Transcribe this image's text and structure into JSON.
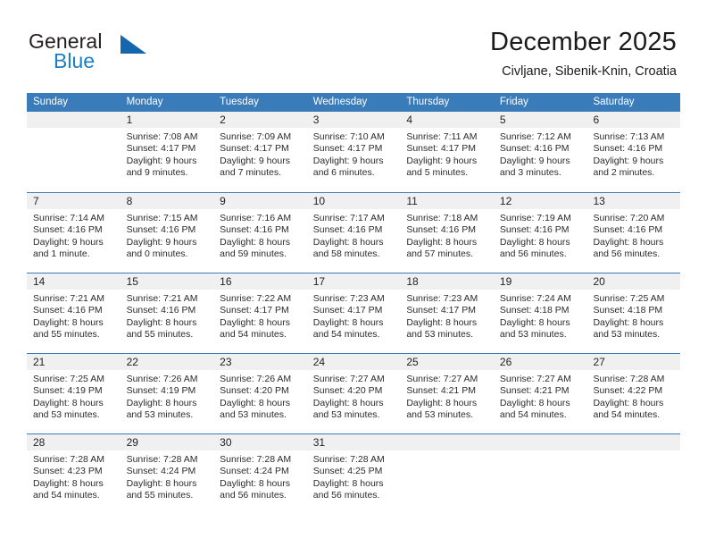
{
  "brand": {
    "name_part1": "General",
    "name_part2": "Blue",
    "accent_color": "#1a7ec8",
    "triangle_color": "#1567ad"
  },
  "header": {
    "title": "December 2025",
    "subtitle": "Civljane, Sibenik-Knin, Croatia"
  },
  "calendar": {
    "header_color": "#3a7cba",
    "weekdays": [
      "Sunday",
      "Monday",
      "Tuesday",
      "Wednesday",
      "Thursday",
      "Friday",
      "Saturday"
    ],
    "weeks": [
      [
        {
          "day": "",
          "empty": true
        },
        {
          "day": "1",
          "sunrise": "Sunrise: 7:08 AM",
          "sunset": "Sunset: 4:17 PM",
          "daylight_line1": "Daylight: 9 hours",
          "daylight_line2": "and 9 minutes."
        },
        {
          "day": "2",
          "sunrise": "Sunrise: 7:09 AM",
          "sunset": "Sunset: 4:17 PM",
          "daylight_line1": "Daylight: 9 hours",
          "daylight_line2": "and 7 minutes."
        },
        {
          "day": "3",
          "sunrise": "Sunrise: 7:10 AM",
          "sunset": "Sunset: 4:17 PM",
          "daylight_line1": "Daylight: 9 hours",
          "daylight_line2": "and 6 minutes."
        },
        {
          "day": "4",
          "sunrise": "Sunrise: 7:11 AM",
          "sunset": "Sunset: 4:17 PM",
          "daylight_line1": "Daylight: 9 hours",
          "daylight_line2": "and 5 minutes."
        },
        {
          "day": "5",
          "sunrise": "Sunrise: 7:12 AM",
          "sunset": "Sunset: 4:16 PM",
          "daylight_line1": "Daylight: 9 hours",
          "daylight_line2": "and 3 minutes."
        },
        {
          "day": "6",
          "sunrise": "Sunrise: 7:13 AM",
          "sunset": "Sunset: 4:16 PM",
          "daylight_line1": "Daylight: 9 hours",
          "daylight_line2": "and 2 minutes."
        }
      ],
      [
        {
          "day": "7",
          "sunrise": "Sunrise: 7:14 AM",
          "sunset": "Sunset: 4:16 PM",
          "daylight_line1": "Daylight: 9 hours",
          "daylight_line2": "and 1 minute."
        },
        {
          "day": "8",
          "sunrise": "Sunrise: 7:15 AM",
          "sunset": "Sunset: 4:16 PM",
          "daylight_line1": "Daylight: 9 hours",
          "daylight_line2": "and 0 minutes."
        },
        {
          "day": "9",
          "sunrise": "Sunrise: 7:16 AM",
          "sunset": "Sunset: 4:16 PM",
          "daylight_line1": "Daylight: 8 hours",
          "daylight_line2": "and 59 minutes."
        },
        {
          "day": "10",
          "sunrise": "Sunrise: 7:17 AM",
          "sunset": "Sunset: 4:16 PM",
          "daylight_line1": "Daylight: 8 hours",
          "daylight_line2": "and 58 minutes."
        },
        {
          "day": "11",
          "sunrise": "Sunrise: 7:18 AM",
          "sunset": "Sunset: 4:16 PM",
          "daylight_line1": "Daylight: 8 hours",
          "daylight_line2": "and 57 minutes."
        },
        {
          "day": "12",
          "sunrise": "Sunrise: 7:19 AM",
          "sunset": "Sunset: 4:16 PM",
          "daylight_line1": "Daylight: 8 hours",
          "daylight_line2": "and 56 minutes."
        },
        {
          "day": "13",
          "sunrise": "Sunrise: 7:20 AM",
          "sunset": "Sunset: 4:16 PM",
          "daylight_line1": "Daylight: 8 hours",
          "daylight_line2": "and 56 minutes."
        }
      ],
      [
        {
          "day": "14",
          "sunrise": "Sunrise: 7:21 AM",
          "sunset": "Sunset: 4:16 PM",
          "daylight_line1": "Daylight: 8 hours",
          "daylight_line2": "and 55 minutes."
        },
        {
          "day": "15",
          "sunrise": "Sunrise: 7:21 AM",
          "sunset": "Sunset: 4:16 PM",
          "daylight_line1": "Daylight: 8 hours",
          "daylight_line2": "and 55 minutes."
        },
        {
          "day": "16",
          "sunrise": "Sunrise: 7:22 AM",
          "sunset": "Sunset: 4:17 PM",
          "daylight_line1": "Daylight: 8 hours",
          "daylight_line2": "and 54 minutes."
        },
        {
          "day": "17",
          "sunrise": "Sunrise: 7:23 AM",
          "sunset": "Sunset: 4:17 PM",
          "daylight_line1": "Daylight: 8 hours",
          "daylight_line2": "and 54 minutes."
        },
        {
          "day": "18",
          "sunrise": "Sunrise: 7:23 AM",
          "sunset": "Sunset: 4:17 PM",
          "daylight_line1": "Daylight: 8 hours",
          "daylight_line2": "and 53 minutes."
        },
        {
          "day": "19",
          "sunrise": "Sunrise: 7:24 AM",
          "sunset": "Sunset: 4:18 PM",
          "daylight_line1": "Daylight: 8 hours",
          "daylight_line2": "and 53 minutes."
        },
        {
          "day": "20",
          "sunrise": "Sunrise: 7:25 AM",
          "sunset": "Sunset: 4:18 PM",
          "daylight_line1": "Daylight: 8 hours",
          "daylight_line2": "and 53 minutes."
        }
      ],
      [
        {
          "day": "21",
          "sunrise": "Sunrise: 7:25 AM",
          "sunset": "Sunset: 4:19 PM",
          "daylight_line1": "Daylight: 8 hours",
          "daylight_line2": "and 53 minutes."
        },
        {
          "day": "22",
          "sunrise": "Sunrise: 7:26 AM",
          "sunset": "Sunset: 4:19 PM",
          "daylight_line1": "Daylight: 8 hours",
          "daylight_line2": "and 53 minutes."
        },
        {
          "day": "23",
          "sunrise": "Sunrise: 7:26 AM",
          "sunset": "Sunset: 4:20 PM",
          "daylight_line1": "Daylight: 8 hours",
          "daylight_line2": "and 53 minutes."
        },
        {
          "day": "24",
          "sunrise": "Sunrise: 7:27 AM",
          "sunset": "Sunset: 4:20 PM",
          "daylight_line1": "Daylight: 8 hours",
          "daylight_line2": "and 53 minutes."
        },
        {
          "day": "25",
          "sunrise": "Sunrise: 7:27 AM",
          "sunset": "Sunset: 4:21 PM",
          "daylight_line1": "Daylight: 8 hours",
          "daylight_line2": "and 53 minutes."
        },
        {
          "day": "26",
          "sunrise": "Sunrise: 7:27 AM",
          "sunset": "Sunset: 4:21 PM",
          "daylight_line1": "Daylight: 8 hours",
          "daylight_line2": "and 54 minutes."
        },
        {
          "day": "27",
          "sunrise": "Sunrise: 7:28 AM",
          "sunset": "Sunset: 4:22 PM",
          "daylight_line1": "Daylight: 8 hours",
          "daylight_line2": "and 54 minutes."
        }
      ],
      [
        {
          "day": "28",
          "sunrise": "Sunrise: 7:28 AM",
          "sunset": "Sunset: 4:23 PM",
          "daylight_line1": "Daylight: 8 hours",
          "daylight_line2": "and 54 minutes."
        },
        {
          "day": "29",
          "sunrise": "Sunrise: 7:28 AM",
          "sunset": "Sunset: 4:24 PM",
          "daylight_line1": "Daylight: 8 hours",
          "daylight_line2": "and 55 minutes."
        },
        {
          "day": "30",
          "sunrise": "Sunrise: 7:28 AM",
          "sunset": "Sunset: 4:24 PM",
          "daylight_line1": "Daylight: 8 hours",
          "daylight_line2": "and 56 minutes."
        },
        {
          "day": "31",
          "sunrise": "Sunrise: 7:28 AM",
          "sunset": "Sunset: 4:25 PM",
          "daylight_line1": "Daylight: 8 hours",
          "daylight_line2": "and 56 minutes."
        },
        {
          "day": "",
          "empty": true
        },
        {
          "day": "",
          "empty": true
        },
        {
          "day": "",
          "empty": true
        }
      ]
    ]
  }
}
